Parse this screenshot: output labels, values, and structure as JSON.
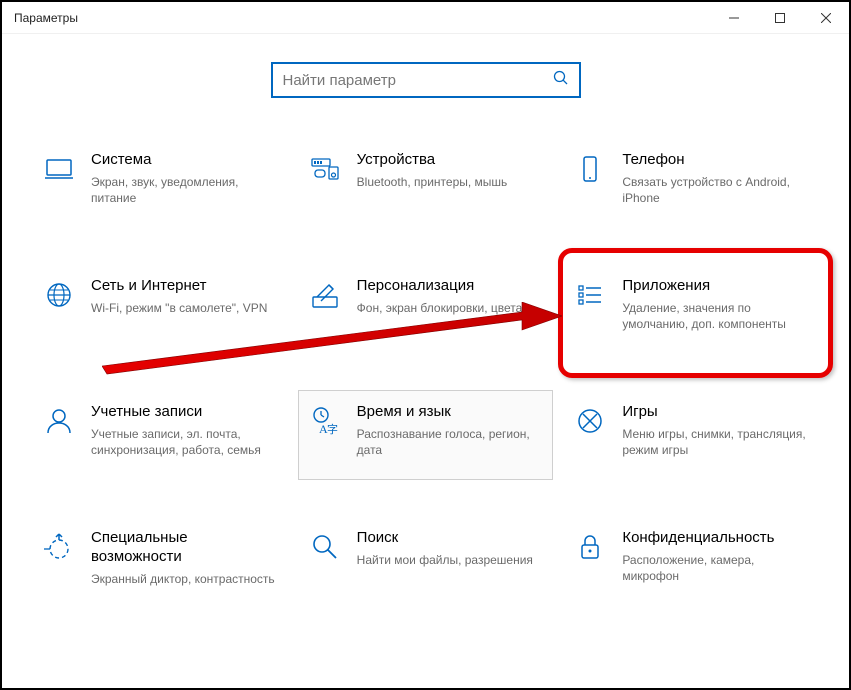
{
  "window": {
    "title": "Параметры"
  },
  "search": {
    "placeholder": "Найти параметр"
  },
  "tiles": {
    "system": {
      "title": "Система",
      "desc": "Экран, звук, уведомления, питание"
    },
    "devices": {
      "title": "Устройства",
      "desc": "Bluetooth, принтеры, мышь"
    },
    "phone": {
      "title": "Телефон",
      "desc": "Связать устройство с Android, iPhone"
    },
    "network": {
      "title": "Сеть и Интернет",
      "desc": "Wi-Fi, режим \"в самолете\", VPN"
    },
    "personalization": {
      "title": "Персонализация",
      "desc": "Фон, экран блокировки, цвета"
    },
    "apps": {
      "title": "Приложения",
      "desc": "Удаление, значения по умолчанию, доп. компоненты"
    },
    "accounts": {
      "title": "Учетные записи",
      "desc": "Учетные записи, эл. почта, синхронизация, работа, семья"
    },
    "timelang": {
      "title": "Время и язык",
      "desc": "Распознавание голоса, регион, дата"
    },
    "gaming": {
      "title": "Игры",
      "desc": "Меню игры, снимки, трансляция, режим игры"
    },
    "ease": {
      "title": "Специальные возможности",
      "desc": "Экранный диктор, контрастность"
    },
    "searchcat": {
      "title": "Поиск",
      "desc": "Найти мои файлы, разрешения"
    },
    "privacy": {
      "title": "Конфиденциальность",
      "desc": "Расположение, камера, микрофон"
    }
  }
}
